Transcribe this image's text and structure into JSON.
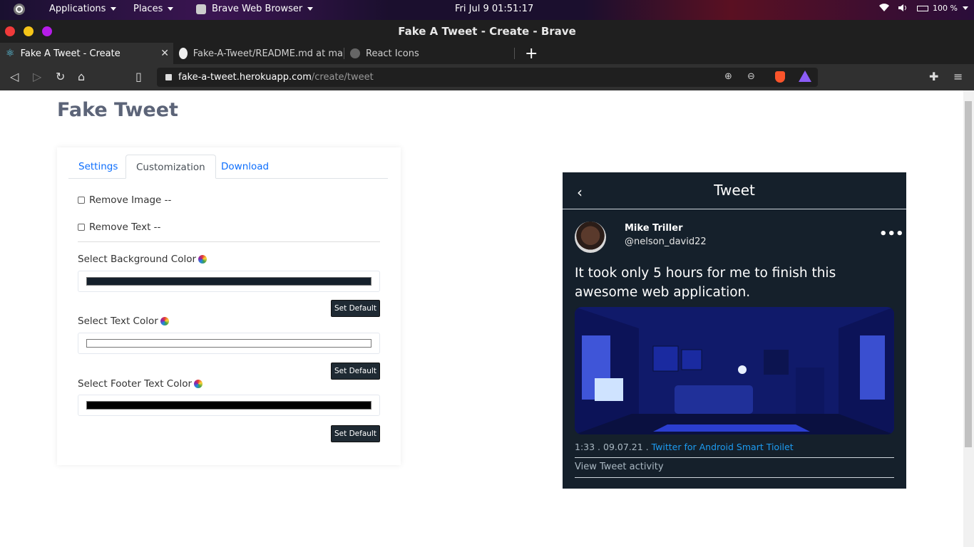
{
  "system": {
    "menus": [
      "Applications",
      "Places",
      "Brave Web Browser"
    ],
    "clock": "Fri Jul 9  01:51:17",
    "battery": "100 %"
  },
  "window": {
    "title": "Fake A Tweet - Create - Brave"
  },
  "tabs": [
    {
      "label": "Fake A Tweet - Create"
    },
    {
      "label": "Fake-A-Tweet/README.md at ma"
    },
    {
      "label": "React Icons"
    }
  ],
  "address": {
    "domain": "fake-a-tweet.herokuapp.com",
    "path": "/create/tweet"
  },
  "app": {
    "title": "Fake Tweet",
    "tabs": [
      "Settings",
      "Customization",
      "Download"
    ],
    "remove_image": "Remove Image --",
    "remove_text": "Remove Text --",
    "bg_color_label": "Select Background Color",
    "text_color_label": "Select Text Color",
    "footer_color_label": "Select Footer Text Color",
    "set_default": "Set Default",
    "bg_color": "#15202b",
    "text_color": "#ffffff",
    "footer_color": "#000000"
  },
  "tweet": {
    "header": "Tweet",
    "name": "Mike Triller",
    "handle": "@nelson_david22",
    "text": "It took only 5 hours for me to finish this awesome web application.",
    "time": "1:33 . 09.07.21 .",
    "source": "Twitter for Android Smart Tioilet",
    "activity": "View Tweet activity"
  }
}
